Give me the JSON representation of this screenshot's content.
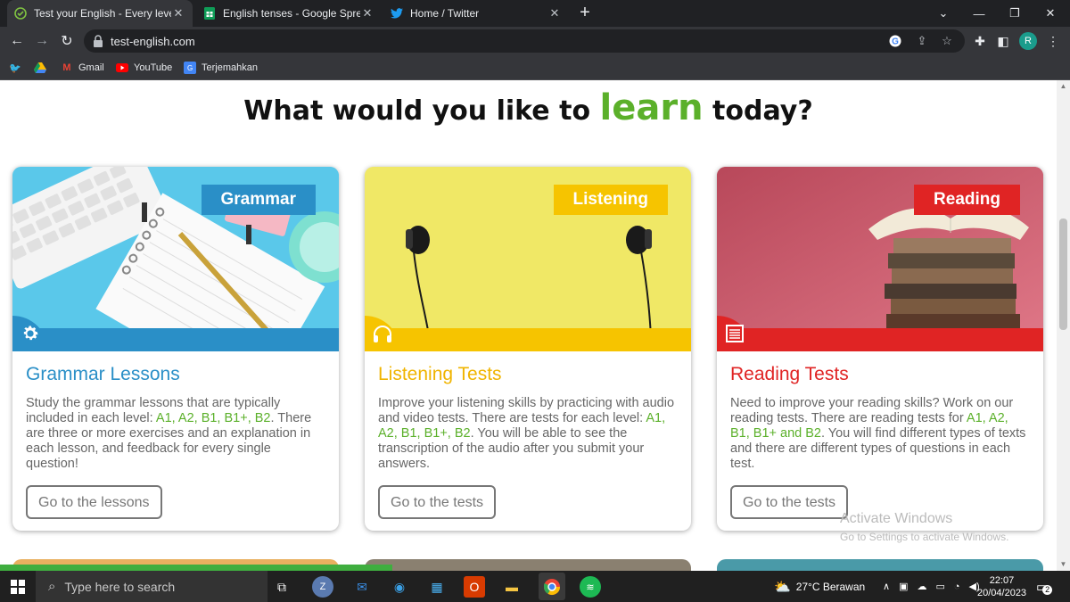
{
  "browser": {
    "tabs": [
      {
        "title": "Test your English - Every level and",
        "active": true
      },
      {
        "title": "English tenses - Google Spreadsh",
        "active": false
      },
      {
        "title": "Home / Twitter",
        "active": false
      }
    ],
    "url": "test-english.com",
    "bookmarks": [
      {
        "label": ""
      },
      {
        "label": ""
      },
      {
        "label": "Gmail"
      },
      {
        "label": "YouTube"
      },
      {
        "label": "Terjemahkan"
      }
    ],
    "profile_initial": "R"
  },
  "page": {
    "headline_pre": "What would you like to",
    "headline_accent": "learn",
    "headline_post": "today?",
    "cards": [
      {
        "label": "Grammar",
        "title": "Grammar Lessons",
        "desc_pre": "Study the grammar lessons that are typically included in each level: ",
        "levels": "A1, A2, B1, B1+, B2",
        "desc_post": ". There are three or more exercises and an explanation in each lesson, and feedback for every single question!",
        "button": "Go to the lessons",
        "color": "#2a8fc7"
      },
      {
        "label": "Listening",
        "title": "Listening Tests",
        "desc_pre": "Improve your listening skills by practicing with audio and video tests. There are tests for each level: ",
        "levels": "A1, A2, B1, B1+, B2",
        "desc_post": ". You will be able to see the transcription of the audio after you submit your answers.",
        "button": "Go to the tests",
        "color": "#f6c400"
      },
      {
        "label": "Reading",
        "title": "Reading Tests",
        "desc_pre": "Need to improve your reading skills? Work on our reading tests. There are reading tests for ",
        "levels": "A1, A2, B1, B1+ and B2",
        "desc_post": ". You will find different types of texts and there are different types of questions in each test.",
        "button": "Go to the tests",
        "color": "#e02424"
      }
    ],
    "watermark_title": "Activate Windows",
    "watermark_sub": "Go to Settings to activate Windows."
  },
  "taskbar": {
    "search_placeholder": "Type here to search",
    "weather": "27°C  Berawan",
    "time": "22:07",
    "date": "20/04/2023",
    "notifications": "2"
  }
}
